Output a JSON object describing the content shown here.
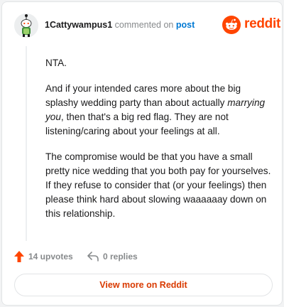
{
  "comment": {
    "username": "1Cattywampus1",
    "verb": "commented on",
    "post_link": "post",
    "paragraphs": [
      {
        "parts": [
          {
            "text": "NTA.",
            "italic": false
          }
        ]
      },
      {
        "parts": [
          {
            "text": "And if your intended cares more about the big splashy wedding party than about actually ",
            "italic": false
          },
          {
            "text": "marrying you",
            "italic": true
          },
          {
            "text": ", then that's a big red flag. They are not listening/caring about your feelings at all.",
            "italic": false
          }
        ]
      },
      {
        "parts": [
          {
            "text": "The compromise would be that you have a small pretty nice wedding that you both pay for yourselves. If they refuse to consider that (or your feelings) then please think hard about slowing waaaaaay down on this relationship.",
            "italic": false
          }
        ]
      }
    ]
  },
  "brand": {
    "wordmark": "reddit",
    "color": "#ff4500"
  },
  "actions": {
    "upvotes_label": "14 upvotes",
    "replies_label": "0 replies"
  },
  "footer": {
    "view_more_label": "View more on Reddit"
  },
  "icons": {
    "avatar": "snoo-avatar-icon",
    "brand": "reddit-logo-icon",
    "upvote": "upvote-arrow-icon",
    "reply": "reply-arrow-icon"
  }
}
